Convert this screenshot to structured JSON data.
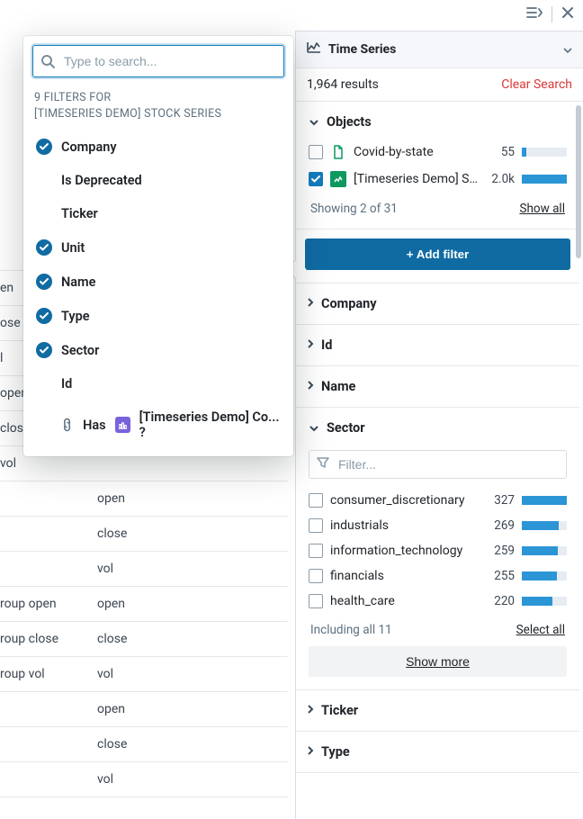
{
  "topbar": {
    "collapse_icon": "panel-collapse-icon",
    "close_icon": "close-icon"
  },
  "bg_rows": [
    {
      "a": "en",
      "b": ""
    },
    {
      "a": "ose",
      "b": ""
    },
    {
      "a": "l",
      "b": ""
    },
    {
      "a": " open",
      "b": ""
    },
    {
      "a": " close",
      "b": ""
    },
    {
      "a": " vol",
      "b": ""
    },
    {
      "a": "",
      "b": "open"
    },
    {
      "a": "",
      "b": "close"
    },
    {
      "a": "",
      "b": "vol"
    },
    {
      "a": "roup open",
      "b": "open"
    },
    {
      "a": "roup close",
      "b": "close"
    },
    {
      "a": "roup vol",
      "b": "vol"
    },
    {
      "a": "",
      "b": "open"
    },
    {
      "a": "",
      "b": "close"
    },
    {
      "a": "",
      "b": "vol"
    }
  ],
  "popover": {
    "search_placeholder": "Type to search...",
    "heading1": "9 FILTERS FOR",
    "heading2": "[TIMESERIES DEMO] STOCK SERIES",
    "items": [
      {
        "label": "Company",
        "checked": true
      },
      {
        "label": "Is Deprecated",
        "checked": false
      },
      {
        "label": "Ticker",
        "checked": false
      },
      {
        "label": "Unit",
        "checked": true
      },
      {
        "label": "Name",
        "checked": true
      },
      {
        "label": "Type",
        "checked": true
      },
      {
        "label": "Sector",
        "checked": true
      },
      {
        "label": "Id",
        "checked": false
      }
    ],
    "has_prefix": "Has",
    "has_label": "[Timeseries Demo] Co... ?"
  },
  "panel": {
    "title": "Time Series",
    "results": "1,964 results",
    "clear": "Clear Search",
    "add_filter": "+ Add filter",
    "objects": {
      "title": "Objects",
      "rows": [
        {
          "name": "Covid-by-state",
          "count": "55",
          "pct": 10,
          "checked": false,
          "icon": "doc-outline"
        },
        {
          "name": "[Timeseries Demo] Stock",
          "count": "2.0k",
          "pct": 100,
          "checked": true,
          "icon": "doc-chart"
        }
      ],
      "showing": "Showing 2 of 31",
      "show_all": "Show all"
    },
    "collapsed": [
      "Company",
      "Id",
      "Name"
    ],
    "sector": {
      "title": "Sector",
      "filter_placeholder": "Filter...",
      "rows": [
        {
          "name": "consumer_discretionary",
          "count": "327",
          "pct": 100
        },
        {
          "name": "industrials",
          "count": "269",
          "pct": 82
        },
        {
          "name": "information_technology",
          "count": "259",
          "pct": 79
        },
        {
          "name": "financials",
          "count": "255",
          "pct": 78
        },
        {
          "name": "health_care",
          "count": "220",
          "pct": 67
        }
      ],
      "including": "Including all 11",
      "select_all": "Select all",
      "show_more": "Show more"
    },
    "collapsed_after": [
      "Ticker",
      "Type"
    ]
  }
}
